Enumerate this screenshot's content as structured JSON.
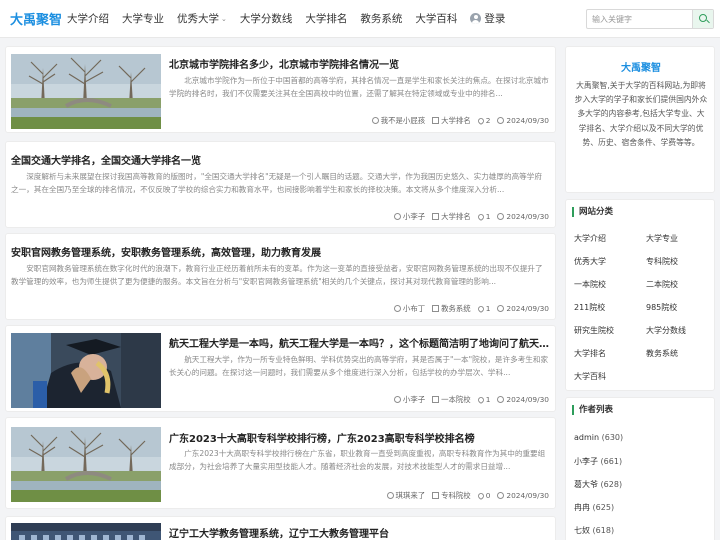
{
  "site": {
    "logo": "大禹聚智"
  },
  "nav": [
    {
      "label": "大学介绍"
    },
    {
      "label": "大学专业"
    },
    {
      "label": "优秀大学",
      "dropdown": true
    },
    {
      "label": "大学分数线"
    },
    {
      "label": "大学排名"
    },
    {
      "label": "教务系统"
    },
    {
      "label": "大学百科"
    }
  ],
  "login": "登录",
  "search": {
    "placeholder": "输入关键字"
  },
  "articles": [
    {
      "title": "北京城市学院排名多少，北京城市学院排名情况一览",
      "excerpt": "北京城市学院作为一所位于中国首都的高等学府，其排名情况一直是学生和家长关注的焦点。在探讨北京城市学院的排名时，我们不仅需要关注其在全国高校中的位置，还需了解其在特定领域或专业中的排名...",
      "author": "我不是小屁孩",
      "category": "大学排名",
      "likes": "2",
      "date": "2024/09/30",
      "image": "park"
    },
    {
      "title": "全国交通大学排名，全国交通大学排名一览",
      "excerpt": "深度解析与未来展望在探讨我国高等教育的版图时，\"全国交通大学排名\"无疑是一个引人瞩目的话题。交通大学，作为我国历史悠久、实力雄厚的高等学府之一，其在全国乃至全球的排名情况，不仅反映了学校的综合实力和教育水平，也间接影响着学生和家长的择校决策。本文将从多个维度深入分析...",
      "author": "小李子",
      "category": "大学排名",
      "likes": "1",
      "date": "2024/09/30",
      "image": ""
    },
    {
      "title": "安职官网教务管理系统，安职教务管理系统，高效管理，助力教育发展",
      "excerpt": "安职官网教务管理系统在数字化时代的浪潮下，教育行业正经历着前所未有的变革。作为这一变革的直接受益者，安职官网教务管理系统的出现不仅提升了教学管理的效率，也为师生提供了更为便捷的服务。本文旨在分析与\"安职官网教务管理系统\"相关的几个关键点，探讨其对现代教育管理的影响...",
      "author": "小布丁",
      "category": "教务系统",
      "likes": "1",
      "date": "2024/09/30",
      "image": ""
    },
    {
      "title": "航天工程大学是一本吗，航天工程大学是一本吗？，这个标题简洁明了地询问了航天工程大学的...",
      "excerpt": "航天工程大学，作为一所专业特色鲜明、学科优势突出的高等学府，其是否属于\"一本\"院校，是许多考生和家长关心的问题。在探讨这一问题时，我们需要从多个维度进行深入分析，包括学校的办学层次、学科...",
      "author": "小李子",
      "category": "一本院校",
      "likes": "1",
      "date": "2024/09/30",
      "image": "graduate"
    },
    {
      "title": "广东2023十大高职专科学校排行榜，广东2023高职专科学校排名榜",
      "excerpt": "广东2023十大高职专科学校排行榜在广东省，职业教育一直受到高度重视，高职专科教育作为其中的重要组成部分，为社会培养了大量实用型技能人才。随着经济社会的发展，对技术技能型人才的需求日益增...",
      "author": "琪琪来了",
      "category": "专科院校",
      "likes": "0",
      "date": "2024/09/30",
      "image": "park"
    },
    {
      "title": "辽宁工大学教务管理系统，辽宁工大教务管理平台",
      "excerpt": "",
      "author": "",
      "category": "",
      "likes": "",
      "date": "",
      "image": "building"
    }
  ],
  "about": {
    "title": "大禹聚智",
    "text": "大禹聚智,关于大学的百科网站,为即将步入大学的学子和家长们提供国内外众多大学的内容参考,包括大学专业、大学排名、大学介绍以及不同大学的优势、历史、宿舍条件、学费等等。"
  },
  "categories": {
    "heading": "网站分类",
    "items": [
      "大学介绍",
      "大学专业",
      "优秀大学",
      "专科院校",
      "一本院校",
      "二本院校",
      "211院校",
      "985院校",
      "研究生院校",
      "大学分数线",
      "大学排名",
      "教务系统",
      "大学百科"
    ]
  },
  "authors": {
    "heading": "作者列表",
    "items": [
      {
        "name": "admin",
        "count": "(630)"
      },
      {
        "name": "小李子",
        "count": "(661)"
      },
      {
        "name": "葛大爷",
        "count": "(628)"
      },
      {
        "name": "冉冉",
        "count": "(625)"
      },
      {
        "name": "七奴",
        "count": "(618)"
      }
    ]
  }
}
